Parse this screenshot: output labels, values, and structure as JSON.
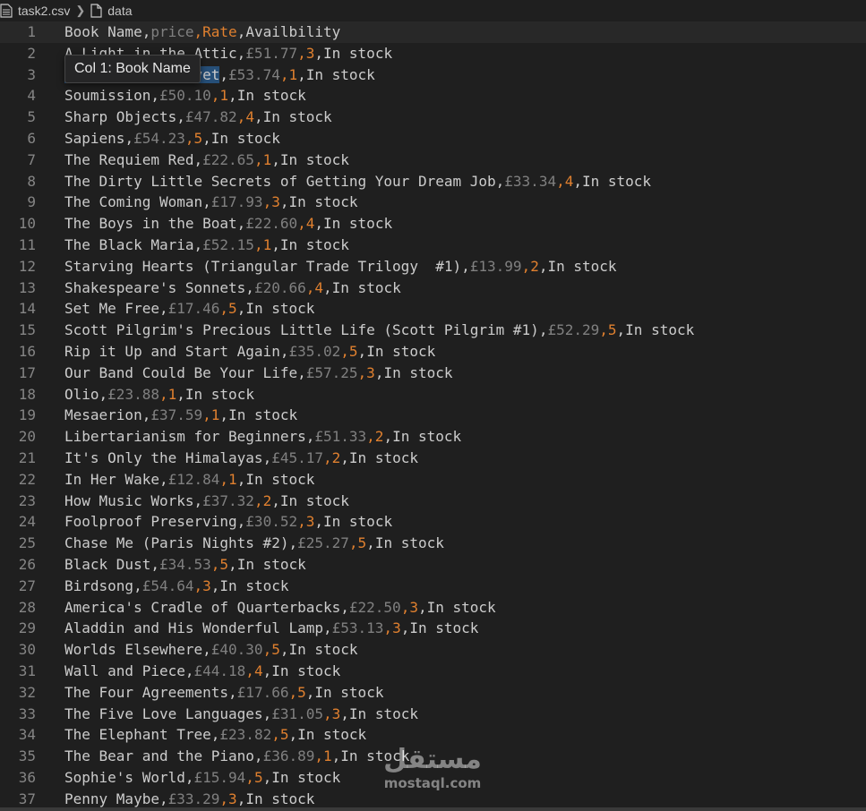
{
  "breadcrumb": {
    "file": "task2.csv",
    "section": "data"
  },
  "hover_tooltip": "Col 1: Book Name",
  "watermark": {
    "arabic": "مستقل",
    "latin": "mostaql.com"
  },
  "rows": [
    {
      "n": "1",
      "name": "Book Name",
      "price": "price",
      "rate": "Rate",
      "avail": "Availbility"
    },
    {
      "n": "2",
      "name": "A Light in the Attic",
      "price": "£51.77",
      "rate": "3",
      "avail": "In stock"
    },
    {
      "n": "3",
      "name": "Tipping the Velvet",
      "price": "£53.74",
      "rate": "1",
      "avail": "In stock"
    },
    {
      "n": "4",
      "name": "Soumission",
      "price": "£50.10",
      "rate": "1",
      "avail": "In stock"
    },
    {
      "n": "5",
      "name": "Sharp Objects",
      "price": "£47.82",
      "rate": "4",
      "avail": "In stock"
    },
    {
      "n": "6",
      "name": "Sapiens",
      "price": "£54.23",
      "rate": "5",
      "avail": "In stock"
    },
    {
      "n": "7",
      "name": "The Requiem Red",
      "price": "£22.65",
      "rate": "1",
      "avail": "In stock"
    },
    {
      "n": "8",
      "name": "The Dirty Little Secrets of Getting Your Dream Job",
      "price": "£33.34",
      "rate": "4",
      "avail": "In stock"
    },
    {
      "n": "9",
      "name": "The Coming Woman",
      "price": "£17.93",
      "rate": "3",
      "avail": "In stock"
    },
    {
      "n": "10",
      "name": "The Boys in the Boat",
      "price": "£22.60",
      "rate": "4",
      "avail": "In stock"
    },
    {
      "n": "11",
      "name": "The Black Maria",
      "price": "£52.15",
      "rate": "1",
      "avail": "In stock"
    },
    {
      "n": "12",
      "name": "Starving Hearts (Triangular Trade Trilogy  #1)",
      "price": "£13.99",
      "rate": "2",
      "avail": "In stock"
    },
    {
      "n": "13",
      "name": "Shakespeare's Sonnets",
      "price": "£20.66",
      "rate": "4",
      "avail": "In stock"
    },
    {
      "n": "14",
      "name": "Set Me Free",
      "price": "£17.46",
      "rate": "5",
      "avail": "In stock"
    },
    {
      "n": "15",
      "name": "Scott Pilgrim's Precious Little Life (Scott Pilgrim #1)",
      "price": "£52.29",
      "rate": "5",
      "avail": "In stock"
    },
    {
      "n": "16",
      "name": "Rip it Up and Start Again",
      "price": "£35.02",
      "rate": "5",
      "avail": "In stock"
    },
    {
      "n": "17",
      "name": "Our Band Could Be Your Life",
      "price": "£57.25",
      "rate": "3",
      "avail": "In stock"
    },
    {
      "n": "18",
      "name": "Olio",
      "price": "£23.88",
      "rate": "1",
      "avail": "In stock"
    },
    {
      "n": "19",
      "name": "Mesaerion",
      "price": "£37.59",
      "rate": "1",
      "avail": "In stock"
    },
    {
      "n": "20",
      "name": "Libertarianism for Beginners",
      "price": "£51.33",
      "rate": "2",
      "avail": "In stock"
    },
    {
      "n": "21",
      "name": "It's Only the Himalayas",
      "price": "£45.17",
      "rate": "2",
      "avail": "In stock"
    },
    {
      "n": "22",
      "name": "In Her Wake",
      "price": "£12.84",
      "rate": "1",
      "avail": "In stock"
    },
    {
      "n": "23",
      "name": "How Music Works",
      "price": "£37.32",
      "rate": "2",
      "avail": "In stock"
    },
    {
      "n": "24",
      "name": "Foolproof Preserving",
      "price": "£30.52",
      "rate": "3",
      "avail": "In stock"
    },
    {
      "n": "25",
      "name": "Chase Me (Paris Nights #2)",
      "price": "£25.27",
      "rate": "5",
      "avail": "In stock"
    },
    {
      "n": "26",
      "name": "Black Dust",
      "price": "£34.53",
      "rate": "5",
      "avail": "In stock"
    },
    {
      "n": "27",
      "name": "Birdsong",
      "price": "£54.64",
      "rate": "3",
      "avail": "In stock"
    },
    {
      "n": "28",
      "name": "America's Cradle of Quarterbacks",
      "price": "£22.50",
      "rate": "3",
      "avail": "In stock"
    },
    {
      "n": "29",
      "name": "Aladdin and His Wonderful Lamp",
      "price": "£53.13",
      "rate": "3",
      "avail": "In stock"
    },
    {
      "n": "30",
      "name": "Worlds Elsewhere",
      "price": "£40.30",
      "rate": "5",
      "avail": "In stock"
    },
    {
      "n": "31",
      "name": "Wall and Piece",
      "price": "£44.18",
      "rate": "4",
      "avail": "In stock"
    },
    {
      "n": "32",
      "name": "The Four Agreements",
      "price": "£17.66",
      "rate": "5",
      "avail": "In stock"
    },
    {
      "n": "33",
      "name": "The Five Love Languages",
      "price": "£31.05",
      "rate": "3",
      "avail": "In stock"
    },
    {
      "n": "34",
      "name": "The Elephant Tree",
      "price": "£23.82",
      "rate": "5",
      "avail": "In stock"
    },
    {
      "n": "35",
      "name": "The Bear and the Piano",
      "price": "£36.89",
      "rate": "1",
      "avail": "In stock"
    },
    {
      "n": "36",
      "name": "Sophie's World",
      "price": "£15.94",
      "rate": "5",
      "avail": "In stock"
    },
    {
      "n": "37",
      "name": "Penny Maybe",
      "price": "£33.29",
      "rate": "3",
      "avail": "In stock"
    }
  ]
}
